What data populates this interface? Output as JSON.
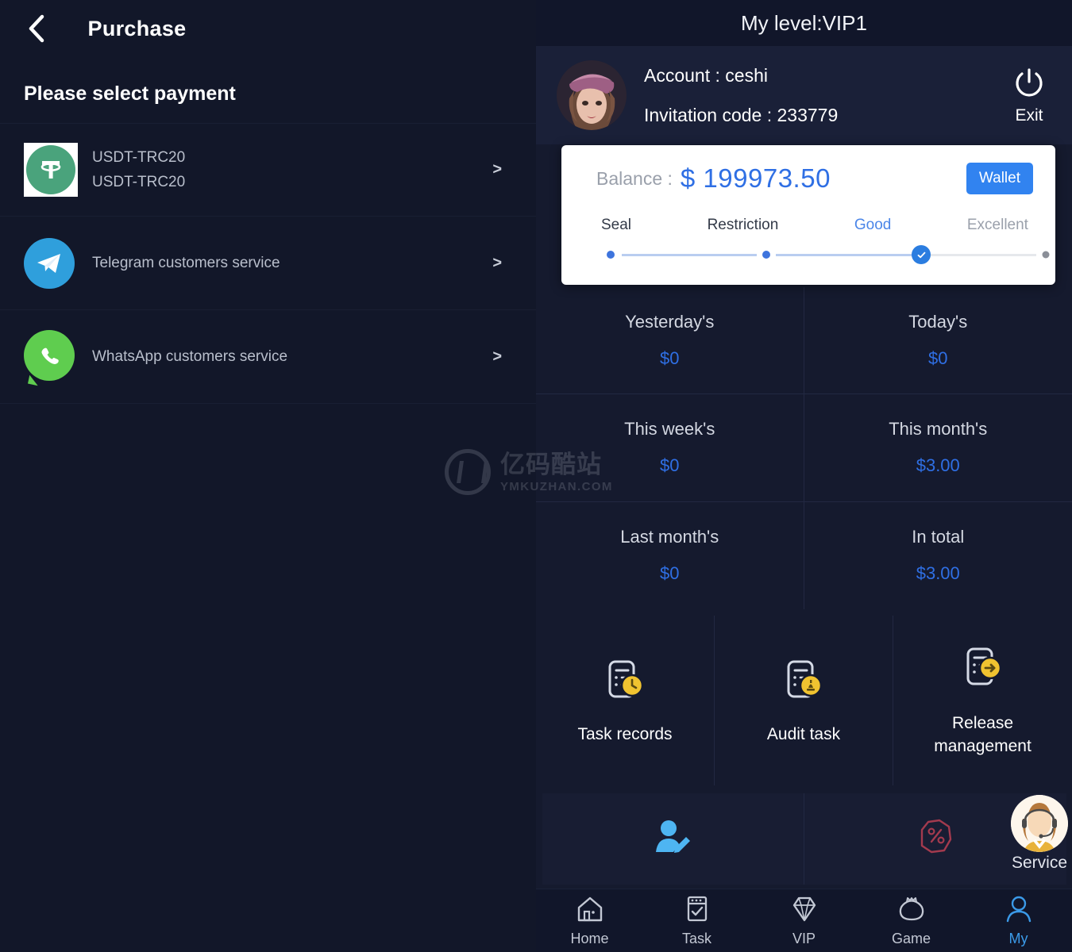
{
  "left": {
    "back_icon": "chevron-left-icon",
    "title": "Purchase",
    "section_title": "Please select payment",
    "chevron": ">",
    "payment_methods": [
      {
        "icon": "tether-usdt-icon",
        "line1": "USDT-TRC20",
        "line2": "USDT-TRC20"
      },
      {
        "icon": "telegram-icon",
        "line1": "Telegram customers service",
        "line2": ""
      },
      {
        "icon": "whatsapp-icon",
        "line1": "WhatsApp customers service",
        "line2": ""
      }
    ]
  },
  "watermark": {
    "cn": "亿码酷站",
    "en": "YMKUZHAN.COM"
  },
  "right": {
    "header_title": "My level:VIP1",
    "account": {
      "avatar_icon": "user-avatar-image",
      "account_line": "Account : ceshi",
      "invitation_line": "Invitation code : 233779",
      "exit_icon": "power-icon",
      "exit_label": "Exit"
    },
    "balance_card": {
      "label": "Balance :",
      "value": "$ 199973.50",
      "wallet_button": "Wallet",
      "steps": [
        {
          "label": "Seal",
          "state": "dark"
        },
        {
          "label": "Restriction",
          "state": "dark"
        },
        {
          "label": "Good",
          "state": "active"
        },
        {
          "label": "Excellent",
          "state": "muted"
        }
      ]
    },
    "stats": [
      {
        "label": "Yesterday's",
        "value": "$0"
      },
      {
        "label": "Today's",
        "value": "$0"
      },
      {
        "label": "This week's",
        "value": "$0"
      },
      {
        "label": "This month's",
        "value": "$3.00"
      },
      {
        "label": "Last month's",
        "value": "$0"
      },
      {
        "label": "In total",
        "value": "$3.00"
      }
    ],
    "tasks": [
      {
        "icon": "task-records-icon",
        "label": "Task records"
      },
      {
        "icon": "audit-task-icon",
        "label": "Audit task"
      },
      {
        "icon": "release-management-icon",
        "label": "Release management"
      }
    ],
    "actions": [
      {
        "icon": "user-edit-icon"
      },
      {
        "icon": "discount-percent-icon"
      }
    ],
    "service": {
      "icon": "customer-service-avatar",
      "label": "Service"
    },
    "bottom_nav": [
      {
        "icon": "home-icon",
        "label": "Home",
        "active": false
      },
      {
        "icon": "task-checklist-icon",
        "label": "Task",
        "active": false
      },
      {
        "icon": "diamond-icon",
        "label": "VIP",
        "active": false
      },
      {
        "icon": "money-bag-icon",
        "label": "Game",
        "active": false
      },
      {
        "icon": "person-icon",
        "label": "My",
        "active": true
      }
    ]
  },
  "colors": {
    "left_bg": "#121729",
    "right_bg": "#151a2e",
    "header_bg": "#11162a",
    "accent_blue": "#2f6fe4",
    "wallet_blue": "#3183f0",
    "nav_active": "#3b9ae8",
    "usdt_green": "#4aa37c",
    "telegram_blue": "#2f9fdc",
    "whatsapp_green": "#5fcd4f",
    "task_icon_yellow": "#f0c330"
  }
}
